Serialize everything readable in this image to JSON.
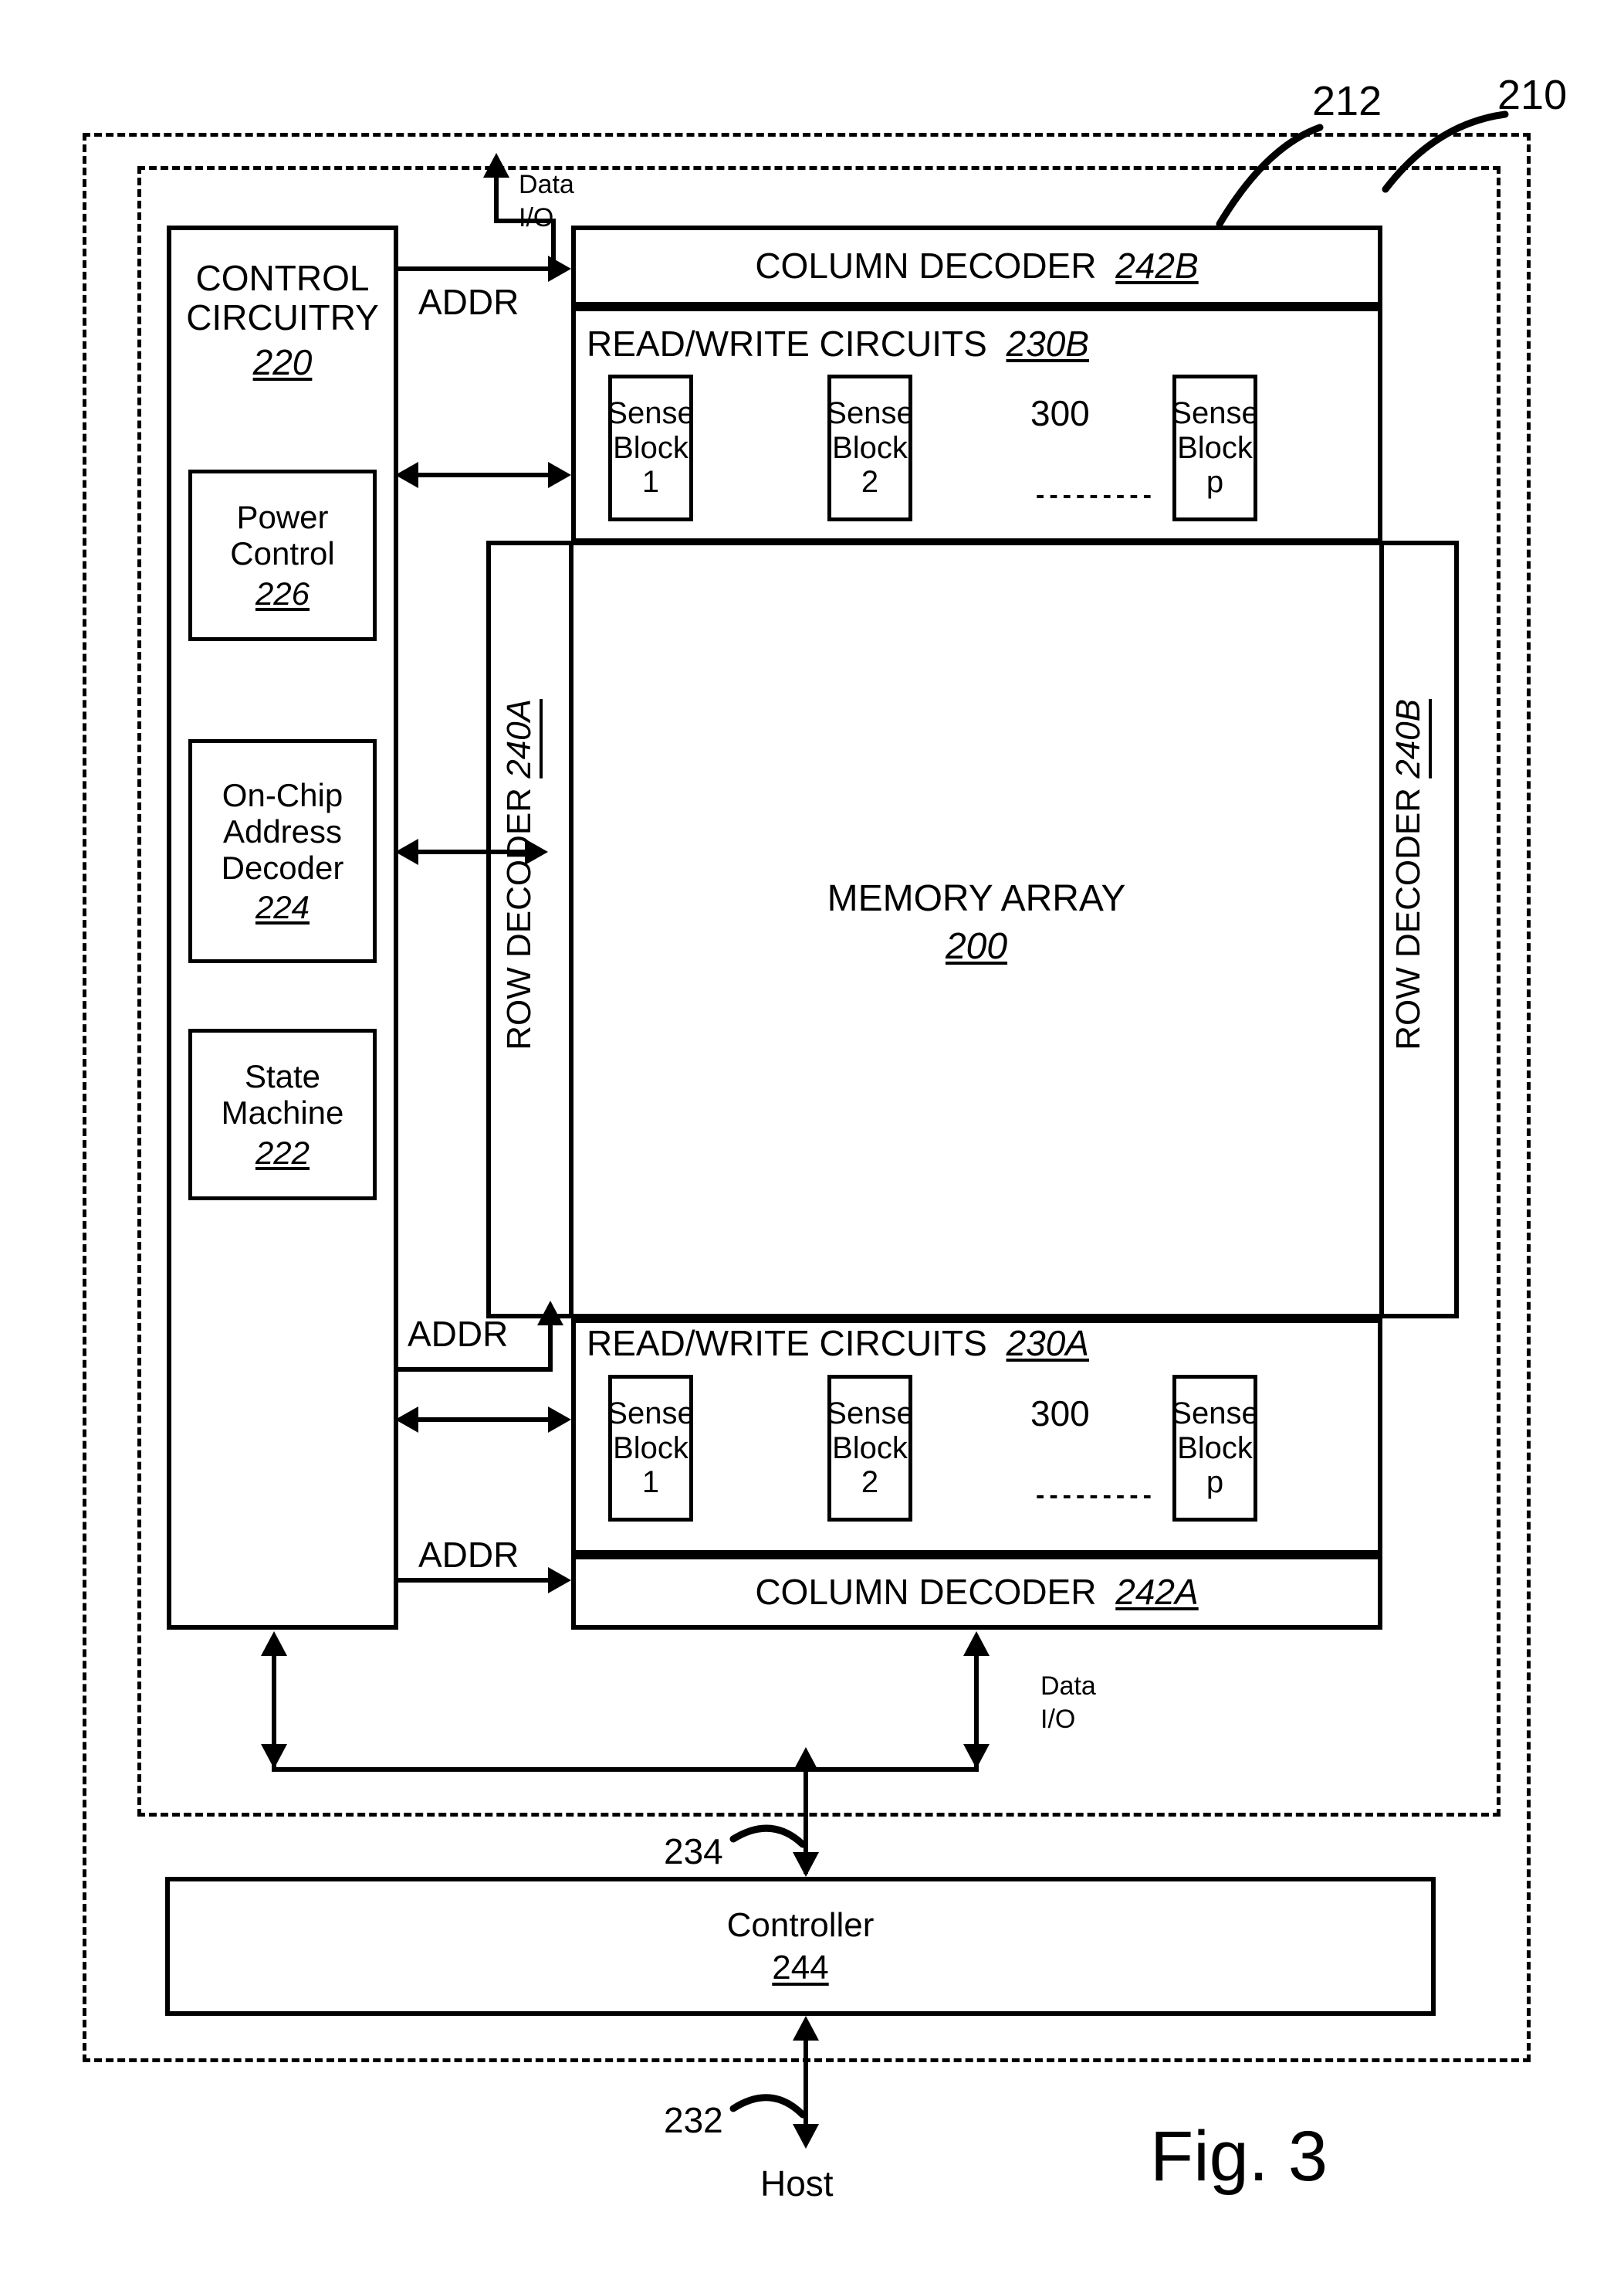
{
  "figure": {
    "caption": "Fig. 3",
    "outer_enclosure_ref": "210",
    "inner_enclosure_ref": "212"
  },
  "control_circuitry": {
    "title_line1": "CONTROL",
    "title_line2": "CIRCUITRY",
    "ref": "220",
    "blocks": [
      {
        "line1": "Power",
        "line2": "Control",
        "ref": "226",
        "name": "power-control"
      },
      {
        "line1": "On-Chip",
        "line2": "Address",
        "line3": "Decoder",
        "ref": "224",
        "name": "on-chip-address-decoder"
      },
      {
        "line1": "State",
        "line2": "Machine",
        "ref": "222",
        "name": "state-machine"
      }
    ]
  },
  "memory_array": {
    "label": "MEMORY ARRAY",
    "ref": "200"
  },
  "row_decoders": [
    {
      "label": "ROW DECODER",
      "ref": "240A",
      "position": "left"
    },
    {
      "label": "ROW DECODER",
      "ref": "240B",
      "position": "right"
    }
  ],
  "column_decoders": [
    {
      "label": "COLUMN DECODER",
      "ref": "242B",
      "position": "top"
    },
    {
      "label": "COLUMN DECODER",
      "ref": "242A",
      "position": "bottom"
    }
  ],
  "read_write_circuits": [
    {
      "label": "READ/WRITE CIRCUITS",
      "ref": "230B",
      "position": "top",
      "sense_block_ref": "300",
      "ellipsis": "---------",
      "sense_blocks": [
        {
          "line1": "Sense",
          "line2": "Block",
          "index": "1"
        },
        {
          "line1": "Sense",
          "line2": "Block",
          "index": "2"
        },
        {
          "line1": "Sense",
          "line2": "Block",
          "index": "p"
        }
      ]
    },
    {
      "label": "READ/WRITE CIRCUITS",
      "ref": "230A",
      "position": "bottom",
      "sense_block_ref": "300",
      "ellipsis": "---------",
      "sense_blocks": [
        {
          "line1": "Sense",
          "line2": "Block",
          "index": "1"
        },
        {
          "line1": "Sense",
          "line2": "Block",
          "index": "2"
        },
        {
          "line1": "Sense",
          "line2": "Block",
          "index": "p"
        }
      ]
    }
  ],
  "controller": {
    "label": "Controller",
    "ref": "244"
  },
  "host": {
    "label": "Host"
  },
  "signals": {
    "addr_top": "ADDR",
    "addr_mid": "ADDR",
    "addr_bottom": "ADDR",
    "data_io_top_line1": "Data",
    "data_io_top_line2": "I/O",
    "data_io_bottom_line1": "Data",
    "data_io_bottom_line2": "I/O",
    "bus_controller_ref": "234",
    "bus_host_ref": "232"
  },
  "colors": {
    "stroke": "#000000",
    "background": "#ffffff"
  }
}
